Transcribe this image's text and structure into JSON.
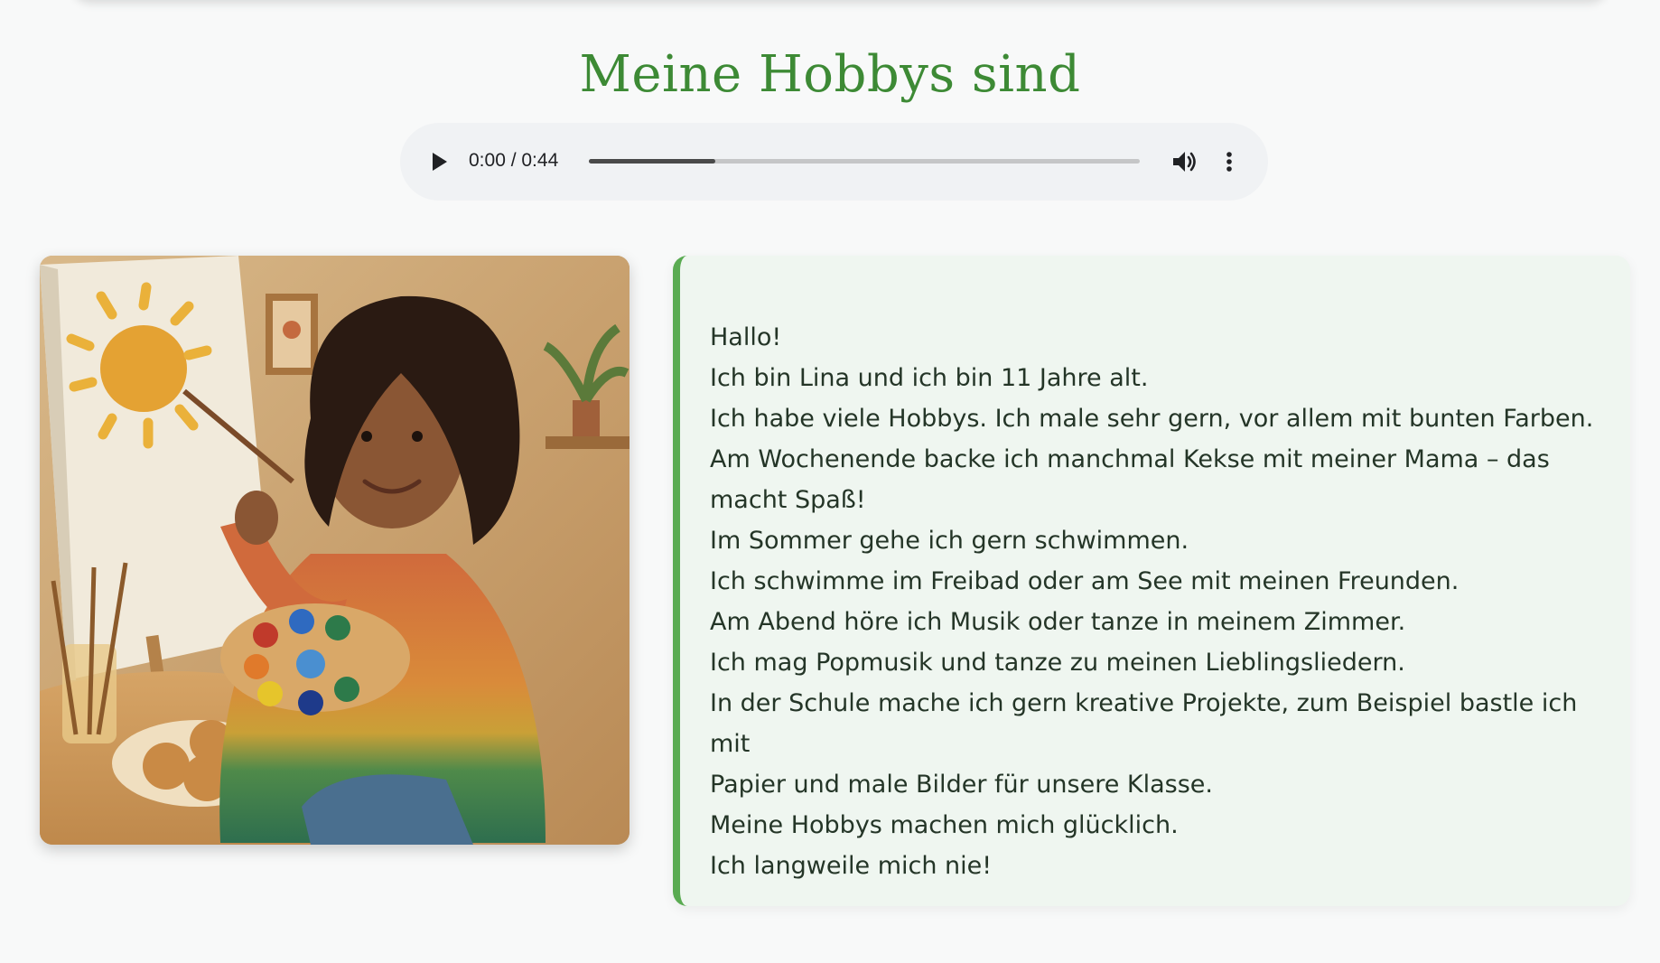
{
  "page": {
    "title": "Meine Hobbys sind"
  },
  "audio_player": {
    "time_display": "0:00 / 0:44",
    "progress_fraction": 0.23,
    "icons": {
      "play": "play-icon",
      "volume": "volume-icon",
      "more": "more-options-icon"
    }
  },
  "illustration": {
    "icon": "girl-painting-illustration"
  },
  "story": {
    "lines": [
      "Hallo!",
      "Ich bin Lina und ich bin 11 Jahre alt.",
      "Ich habe viele Hobbys. Ich male sehr gern, vor allem mit bunten Farben.",
      "Am Wochenende backe ich manchmal Kekse mit meiner Mama – das",
      "macht Spaß!",
      "Im Sommer gehe ich gern schwimmen.",
      "Ich schwimme im Freibad oder am See mit meinen Freunden.",
      "Am Abend höre ich Musik oder tanze in meinem Zimmer.",
      "Ich mag Popmusik und tanze zu meinen Lieblingsliedern.",
      "In der Schule mache ich gern kreative Projekte, zum Beispiel bastle ich mit",
      "Papier und male Bilder für unsere Klasse.",
      "Meine Hobbys machen mich glücklich.",
      "Ich langweile mich nie!"
    ]
  },
  "colors": {
    "accent": "#5aab52",
    "title": "#3d8a35",
    "card_bg": "#eff6f0",
    "page_bg": "#f8f9f9"
  }
}
